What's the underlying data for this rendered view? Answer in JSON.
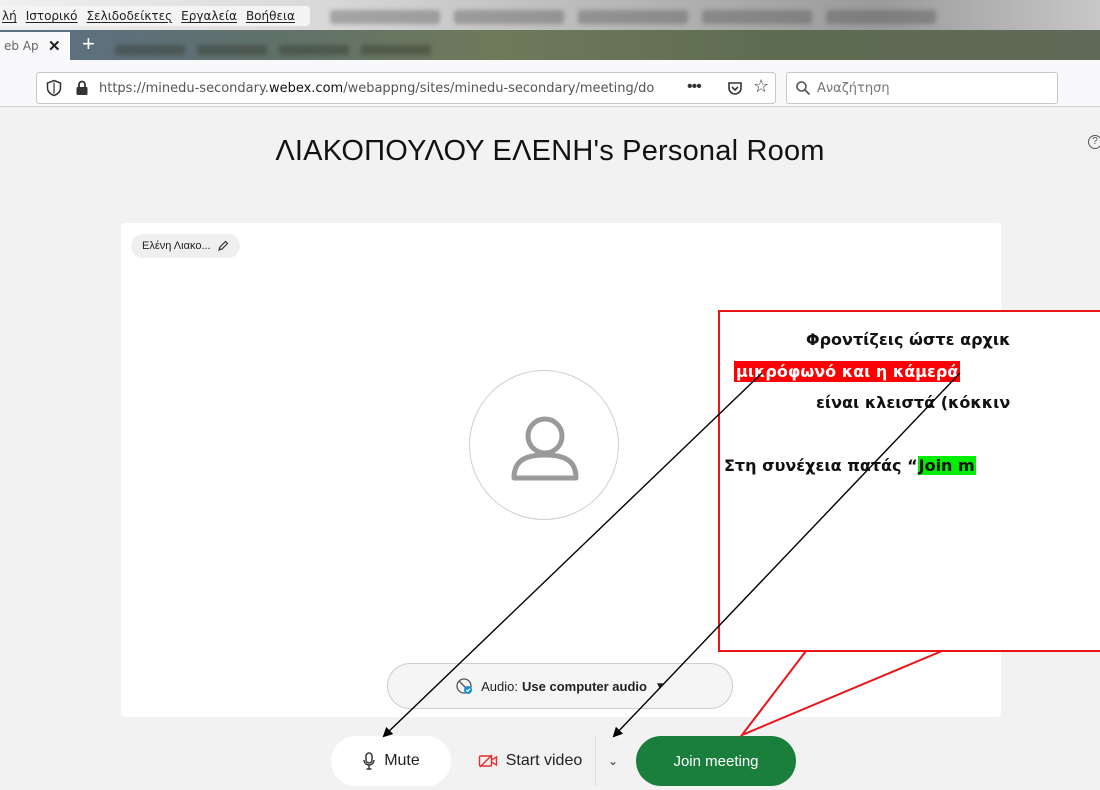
{
  "browser": {
    "menu": [
      "λή",
      "Ιστορικό",
      "Σελιδοδείκτες",
      "Εργαλεία",
      "Βοήθεια"
    ],
    "active_tab_title": "eb Ap",
    "tab_close": "✕",
    "new_tab": "+",
    "url_prefix": "https://minedu-secondary.",
    "url_domain": "webex.com",
    "url_suffix": "/webappng/sites/minedu-secondary/meeting/do",
    "more": "•••",
    "star": "☆",
    "search_placeholder": "Αναζήτηση"
  },
  "page": {
    "title": "ΛΙΑΚΟΠΟΥΛΟΥ ΕΛΕΝΗ's Personal Room",
    "help": "?",
    "name_pill": "Ελένη Λιακο..."
  },
  "audio": {
    "label": "Audio:",
    "value": "Use computer audio",
    "caret": "▼"
  },
  "controls": {
    "mute": "Mute",
    "start_video": "Start video",
    "video_caret": "⌄",
    "join": "Join meeting"
  },
  "callout": {
    "line1": "Φροντίζεις ώστε αρχικ",
    "line2": "μικρόφωνό και η κάμερά",
    "line3": "είναι κλειστά (κόκκιν",
    "line4_prefix": "Στη συνέχεια πατάς “",
    "line4_highlight": "Join m"
  },
  "colors": {
    "join_green": "#1a7f3c",
    "callout_red": "#e81616",
    "highlight_red": "#ff0000",
    "highlight_green": "#00ee00"
  }
}
